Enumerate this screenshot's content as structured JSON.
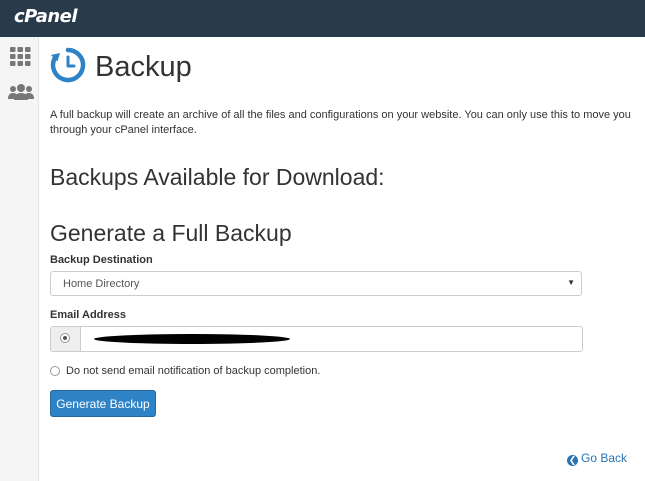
{
  "header": {
    "logo_text": "cPanel"
  },
  "sidebar": {
    "items": [
      {
        "icon": "grid-icon",
        "label": ""
      },
      {
        "icon": "users-icon",
        "label": ""
      }
    ]
  },
  "page": {
    "title": "Backup",
    "description_line1": "A full backup will create an archive of all the files and configurations on your website. You can only use this to move you",
    "description_line2": "through your cPanel interface."
  },
  "available_section": {
    "heading": "Backups Available for Download:"
  },
  "generate_section": {
    "heading": "Generate a Full Backup",
    "destination_label": "Backup Destination",
    "destination_value": "Home Directory",
    "email_label": "Email Address",
    "email_value_redacted": true,
    "no_email_label": "Do not send email notification of backup completion.",
    "generate_button": "Generate Backup"
  },
  "footer": {
    "go_back": "Go Back"
  },
  "colors": {
    "topbar": "#293a4a",
    "accent": "#2e83c7",
    "link": "#2a73b6"
  }
}
